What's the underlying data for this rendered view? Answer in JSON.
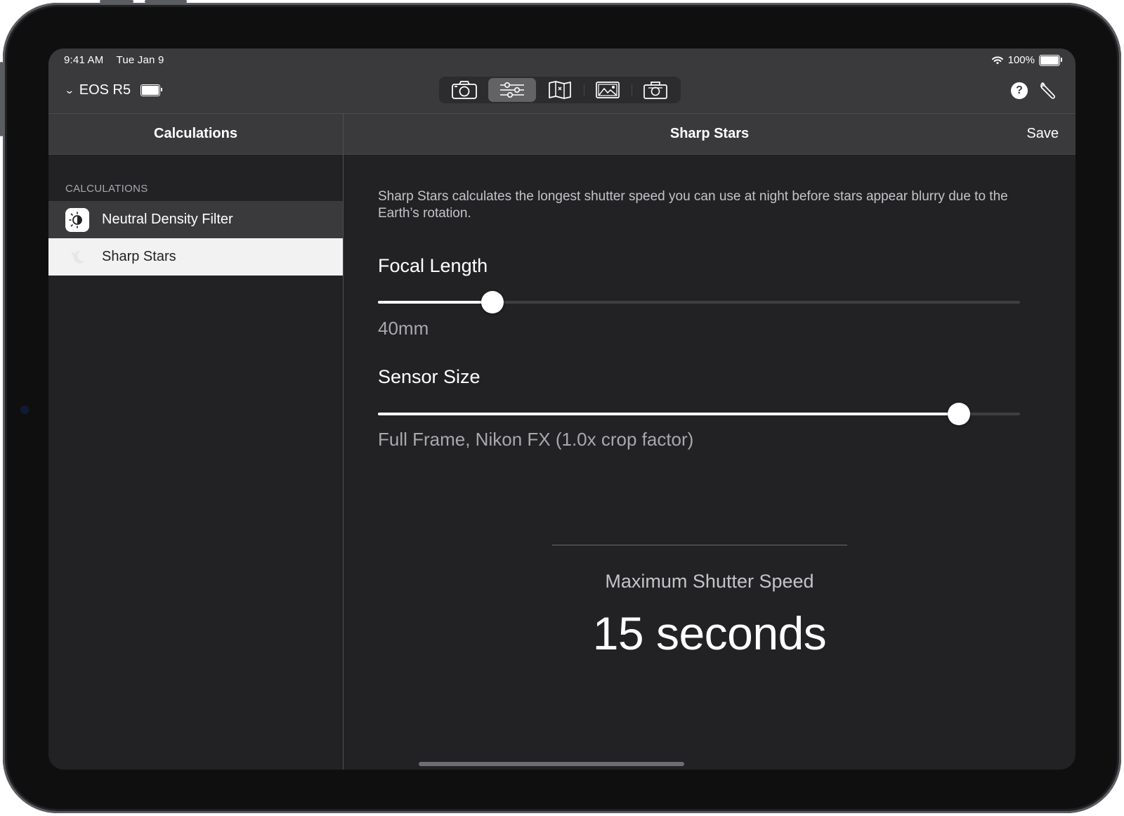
{
  "status_bar": {
    "time": "9:41 AM",
    "date": "Tue Jan 9",
    "battery": "100%"
  },
  "toolbar": {
    "camera_name": "EOS R5",
    "segments": [
      {
        "icon": "camera-icon",
        "active": false
      },
      {
        "icon": "sliders-icon",
        "active": true
      },
      {
        "icon": "map-icon",
        "active": false
      },
      {
        "icon": "photos-icon",
        "active": false
      },
      {
        "icon": "camera-bag-icon",
        "active": false
      }
    ],
    "help_symbol": "?",
    "help_icon": "help-icon",
    "settings_icon": "wrench-icon"
  },
  "sidebar": {
    "title": "Calculations",
    "section_label": "CALCULATIONS",
    "items": [
      {
        "label": "Neutral Density Filter",
        "icon": "nd-filter-icon",
        "selected": false
      },
      {
        "label": "Sharp Stars",
        "icon": "sharp-stars-icon",
        "selected": true
      }
    ]
  },
  "detail": {
    "title": "Sharp Stars",
    "save_label": "Save",
    "description": "Sharp Stars calculates the longest shutter speed you can use at night before stars appear blurry due to the Earth’s rotation.",
    "focal_length": {
      "title": "Focal Length",
      "value": "40mm",
      "slider_fraction": 0.178
    },
    "sensor_size": {
      "title": "Sensor Size",
      "value": "Full Frame, Nikon FX (1.0x crop factor)",
      "slider_fraction": 0.905
    },
    "result_label": "Maximum Shutter Speed",
    "result_value": "15 seconds"
  },
  "colors": {
    "screen_bg": "#222224",
    "bar_bg": "#3a3a3c",
    "selected_row": "#f2f2f3",
    "accent": "#ffffff"
  }
}
